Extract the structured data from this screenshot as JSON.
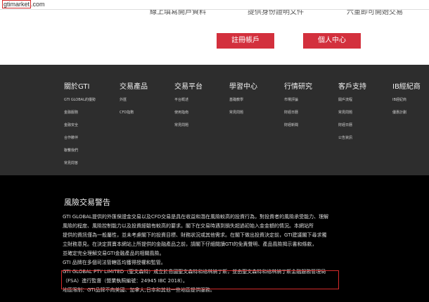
{
  "browser": {
    "url_highlight": "gtimarket",
    "url_rest": ".com"
  },
  "steps": [
    "線上填寫開戶資料",
    "提供身份證明文件",
    "六重即可開始交易"
  ],
  "buttons": {
    "register": "註冊帳戶",
    "personal_center": "個人中心"
  },
  "nav": {
    "about": {
      "heading": "關於GTI",
      "items": [
        "GTI GLOBAL的優勢",
        "金融服務",
        "金融安全",
        "合作夥伴",
        "聯繫我們",
        "常見問答"
      ]
    },
    "products": {
      "heading": "交易產品",
      "items": [
        "外匯",
        "CFD指數"
      ]
    },
    "platform": {
      "heading": "交易平台",
      "items": [
        "平台概述",
        "使用指南",
        "常見問題"
      ]
    },
    "learning": {
      "heading": "學習中心",
      "items": [
        "基礎教學",
        "常見問題"
      ]
    },
    "research": {
      "heading": "行情研究",
      "items": [
        "市場評論",
        "財經日曆",
        "財經新聞"
      ]
    },
    "support": {
      "heading": "客戶支持",
      "items": [
        "開戶流程",
        "常見問題",
        "財經日曆",
        "公告資訊"
      ]
    },
    "ib": {
      "heading": "IB經紀商",
      "items": [
        "IB經紀商",
        "優惠計劃"
      ]
    }
  },
  "risk": {
    "title": "風險交易警告",
    "lines": [
      "GTI GLOBAL提供的外匯保證金交易以及CFD交易是具在收益和潛在風險較高的投資行為，對投資者的風險承受能力、理解",
      "風險的程度、風險控制能力以及投資經驗有較高的要求。閣下在交易時遇到損失超過初始入金金額的情況。本網站所",
      "提供的資訊僅為一般屬性，並未考慮閣下的投資目標、財務狀況或其他需求。在閣下做出投資決定前，GTI建議閣下尋求獨",
      "立財務意見。在決定買賣本網站上所提供的金融產品之前，請閣下仔細閱讀GTI的免責聲明、產品風險揭示書和條款，",
      "並確定完全理解交易GTI金融產品的相關風險。",
      "GTI 品牌在多個司法管轄區均獲得授權和監管。",
      "GTI GLOBAL PTY LIMITED（聖文森特）成立於島國聖文森特和格林納丁斯，並由聖文森特和格林納丁斯金融服務管理局",
      "（FSA）進行監督（營業執照編號：24945 IBC 2018）。",
      "地區限制：GTI品牌不向美國、加拿大,日本和其他一些地區提供服務。"
    ]
  }
}
